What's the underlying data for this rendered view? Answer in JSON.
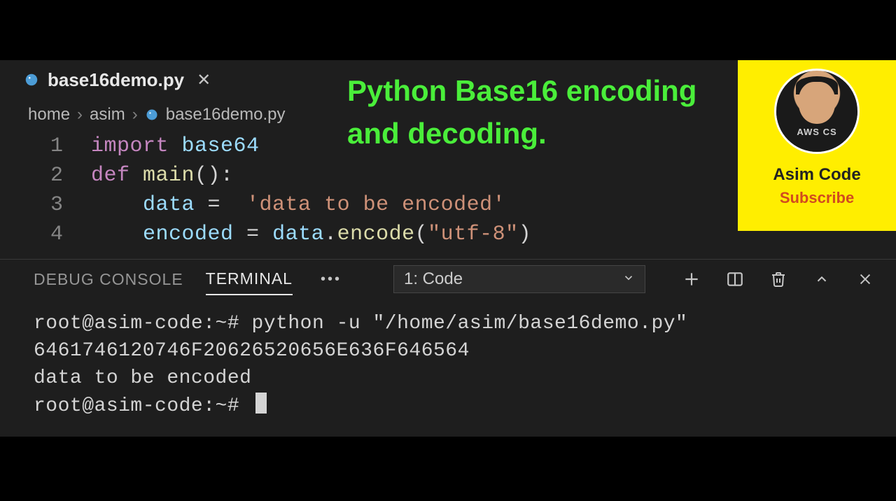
{
  "overlay": {
    "title": "Python Base16 encoding and decoding."
  },
  "channel": {
    "name": "Asim Code",
    "subscribe": "Subscribe",
    "shirt_text": "AWS CS"
  },
  "tab": {
    "filename": "base16demo.py",
    "close": "✕"
  },
  "breadcrumb": {
    "items": [
      "home",
      "asim",
      "base16demo.py"
    ]
  },
  "code": {
    "lines": [
      {
        "n": "1",
        "tokens": [
          {
            "t": "import",
            "c": "kw"
          },
          {
            "t": " ",
            "c": "plain"
          },
          {
            "t": "base64",
            "c": "id"
          }
        ]
      },
      {
        "n": "2",
        "tokens": [
          {
            "t": "def",
            "c": "kw"
          },
          {
            "t": " ",
            "c": "plain"
          },
          {
            "t": "main",
            "c": "fn"
          },
          {
            "t": "():",
            "c": "punc"
          }
        ]
      },
      {
        "n": "3",
        "tokens": [
          {
            "t": "    ",
            "c": "plain"
          },
          {
            "t": "data",
            "c": "id"
          },
          {
            "t": " =  ",
            "c": "plain"
          },
          {
            "t": "'data to be encoded'",
            "c": "str"
          }
        ]
      },
      {
        "n": "4",
        "tokens": [
          {
            "t": "    ",
            "c": "plain"
          },
          {
            "t": "encoded",
            "c": "id"
          },
          {
            "t": " = ",
            "c": "plain"
          },
          {
            "t": "data",
            "c": "id"
          },
          {
            "t": ".",
            "c": "punc"
          },
          {
            "t": "encode",
            "c": "fn"
          },
          {
            "t": "(",
            "c": "punc"
          },
          {
            "t": "\"utf-8\"",
            "c": "str"
          },
          {
            "t": ")",
            "c": "punc"
          }
        ]
      }
    ]
  },
  "panel": {
    "tabs": {
      "debug": "DEBUG CONSOLE",
      "terminal": "TERMINAL"
    },
    "more": "•••",
    "selector": "1: Code"
  },
  "terminal": {
    "lines": [
      "root@asim-code:~# python -u \"/home/asim/base16demo.py\"",
      "6461746120746F20626520656E636F646564",
      "data to be encoded",
      "root@asim-code:~# "
    ]
  }
}
